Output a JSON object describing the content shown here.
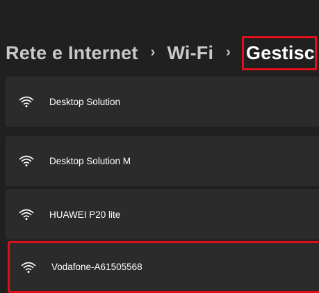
{
  "breadcrumb": {
    "items": [
      "Rete e Internet",
      "Wi-Fi"
    ],
    "separator": "›",
    "current": "Gestisc"
  },
  "networks": [
    {
      "name": "Desktop Solution",
      "icon": "wifi-icon",
      "highlighted": false
    },
    {
      "name": "Desktop Solution M",
      "icon": "wifi-icon",
      "highlighted": false
    },
    {
      "name": "HUAWEI P20 lite",
      "icon": "wifi-icon",
      "highlighted": false
    },
    {
      "name": "Vodafone-A61505568",
      "icon": "wifi-icon",
      "highlighted": true
    }
  ],
  "colors": {
    "background": "#202020",
    "row": "#2b2b2b",
    "highlight": "#e0101a"
  }
}
